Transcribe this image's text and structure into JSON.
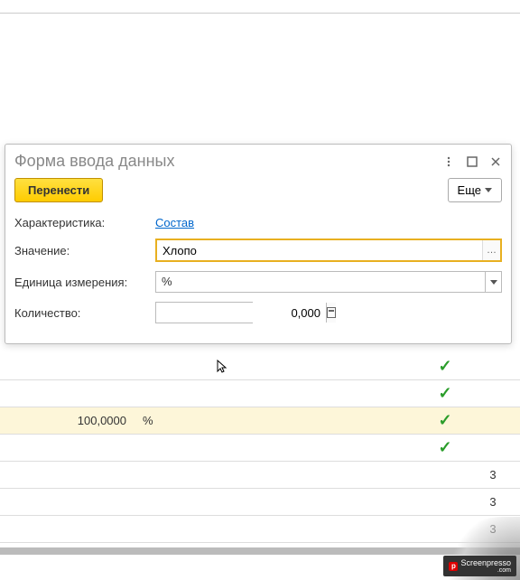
{
  "dialog": {
    "title": "Форма ввода данных",
    "transfer_btn": "Перенести",
    "more_btn": "Еще",
    "fields": {
      "characteristic_label": "Характеристика:",
      "characteristic_link": "Состав",
      "value_label": "Значение:",
      "value_text": "Хлопо",
      "unit_label": "Единица измерения:",
      "unit_text": "%",
      "quantity_label": "Количество:",
      "quantity_value": "0,000"
    }
  },
  "grid": {
    "rows": [
      {
        "num": "",
        "unit": "",
        "check": true,
        "right": ""
      },
      {
        "num": "",
        "unit": "",
        "check": true,
        "right": ""
      },
      {
        "num": "100,0000",
        "unit": "%",
        "check": true,
        "right": "",
        "hl": true
      },
      {
        "num": "",
        "unit": "",
        "check": true,
        "right": ""
      },
      {
        "num": "",
        "unit": "",
        "check": false,
        "right": "3"
      },
      {
        "num": "",
        "unit": "",
        "check": false,
        "right": "3"
      },
      {
        "num": "",
        "unit": "",
        "check": false,
        "right": "3"
      }
    ]
  },
  "watermark": {
    "text": "Screenpresso",
    "sub": ".com",
    "logo": "p"
  }
}
